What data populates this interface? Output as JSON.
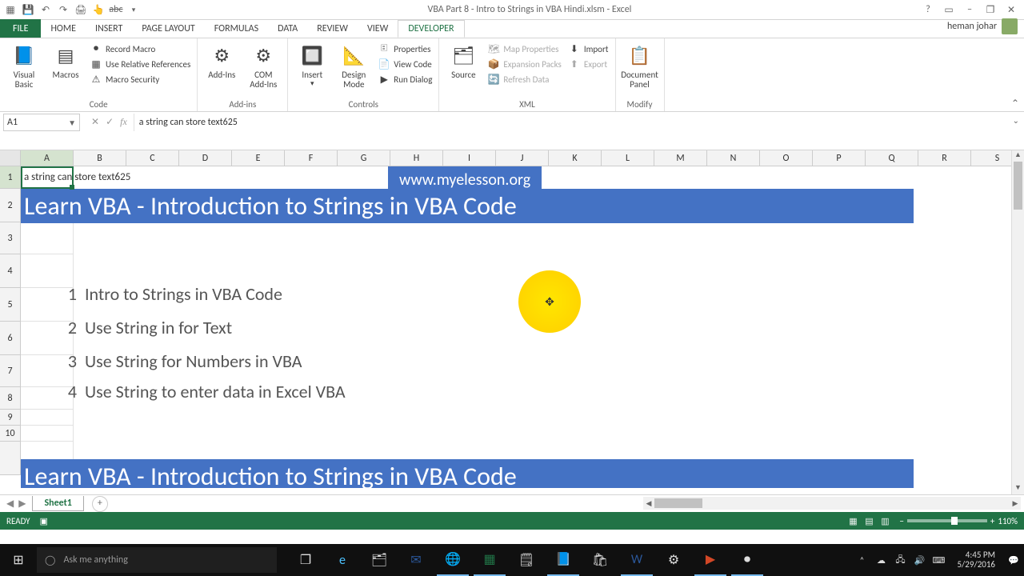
{
  "title": "VBA Part 8 - Intro to Strings in VBA Hindi.xlsm - Excel",
  "tabs": {
    "file": "FILE",
    "list": [
      "HOME",
      "INSERT",
      "PAGE LAYOUT",
      "FORMULAS",
      "DATA",
      "REVIEW",
      "VIEW",
      "DEVELOPER"
    ],
    "active": "DEVELOPER"
  },
  "account": "heman johar",
  "ribbon": {
    "code": {
      "visual_basic": "Visual\nBasic",
      "macros": "Macros",
      "record": "Record Macro",
      "relref": "Use Relative References",
      "security": "Macro Security",
      "label": "Code"
    },
    "addins": {
      "addins": "Add-Ins",
      "com": "COM\nAdd-Ins",
      "label": "Add-ins"
    },
    "controls": {
      "insert": "Insert",
      "design": "Design\nMode",
      "props": "Properties",
      "viewcode": "View Code",
      "rundlg": "Run Dialog",
      "label": "Controls"
    },
    "xml": {
      "source": "Source",
      "map": "Map Properties",
      "expansion": "Expansion Packs",
      "refresh": "Refresh Data",
      "import": "Import",
      "export": "Export",
      "label": "XML"
    },
    "modify": {
      "docpanel": "Document\nPanel",
      "label": "Modify"
    }
  },
  "fbar": {
    "name": "A1",
    "formula": "a string can store text625"
  },
  "columns": [
    "A",
    "B",
    "C",
    "D",
    "E",
    "F",
    "G",
    "H",
    "I",
    "J",
    "K",
    "L",
    "M",
    "N",
    "O",
    "P",
    "Q",
    "R",
    "S"
  ],
  "sheet": {
    "a1": "a string can store text625",
    "url": "www.myelesson.org",
    "heading": "Learn VBA - Introduction to Strings in VBA Code",
    "heading2": "Learn VBA - Introduction to Strings in VBA Code",
    "items": [
      {
        "n": "1",
        "t": "Intro to Strings in VBA Code"
      },
      {
        "n": "2",
        "t": "Use String in for Text"
      },
      {
        "n": "3",
        "t": "Use String for Numbers in VBA"
      },
      {
        "n": "4",
        "t": "Use String to enter data in Excel VBA"
      }
    ]
  },
  "sheettab": "Sheet1",
  "status": {
    "ready": "READY",
    "zoom": "110%"
  },
  "taskbar": {
    "search": "Ask me anything",
    "time": "4:45 PM",
    "date": "5/29/2016"
  }
}
